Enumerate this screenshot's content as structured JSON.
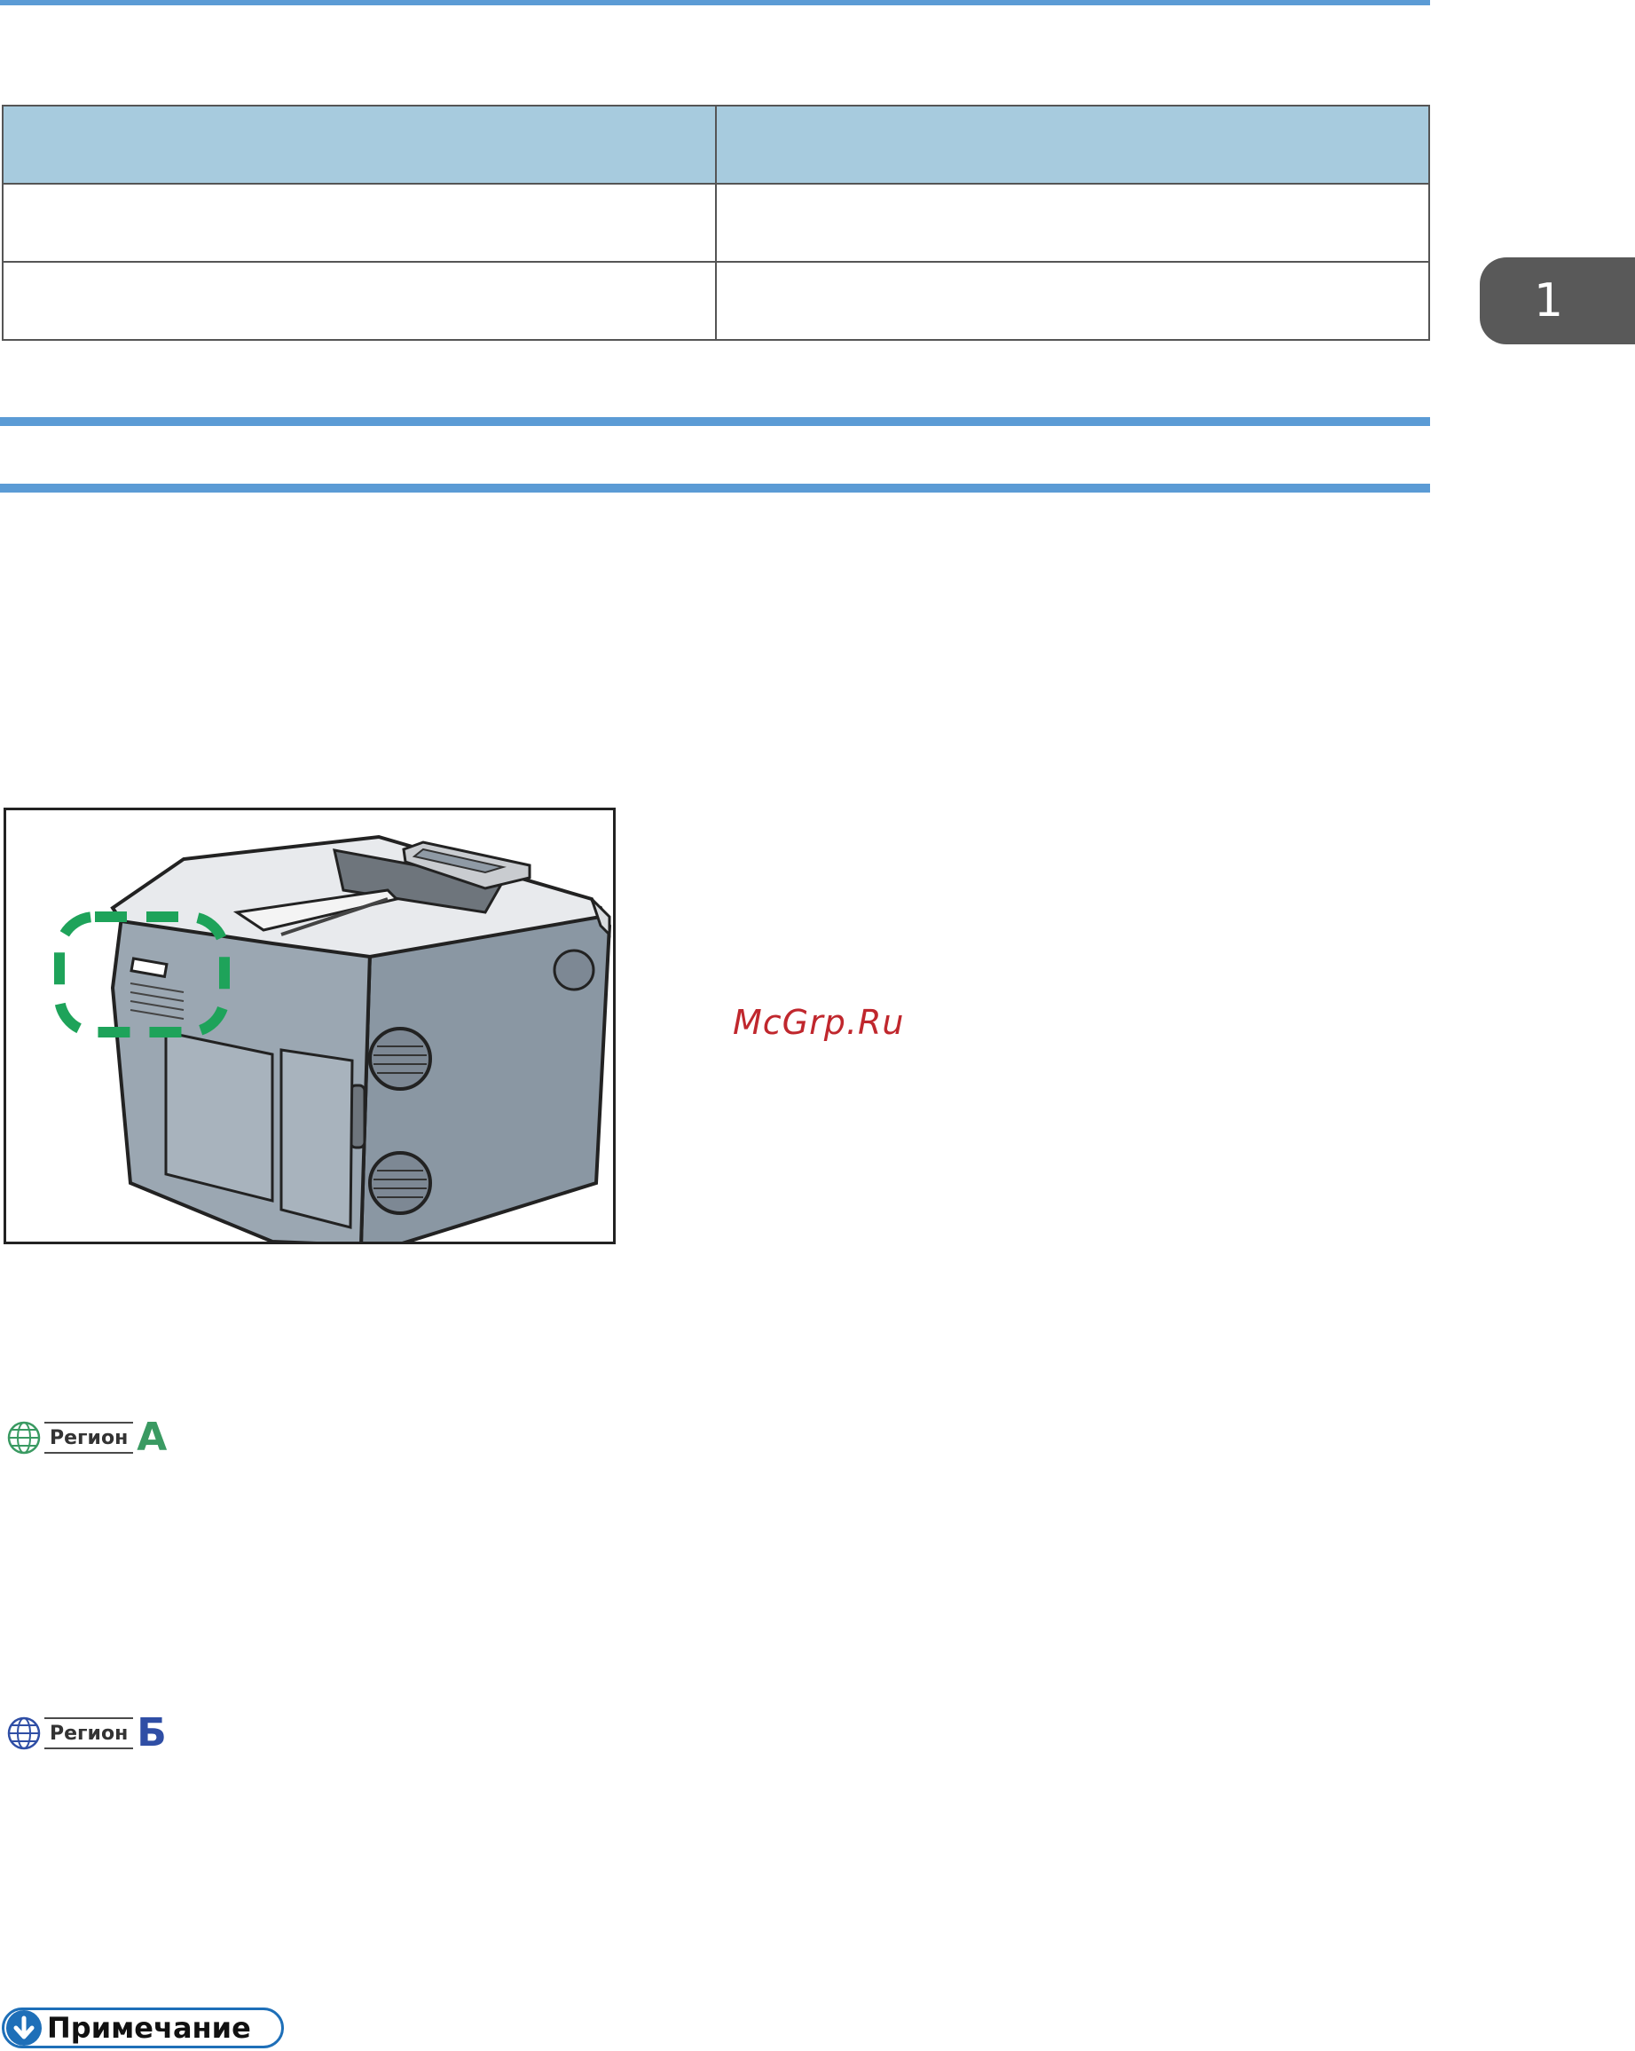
{
  "chapter": {
    "number": "1"
  },
  "table": {
    "header": [
      "",
      ""
    ],
    "rows": [
      [
        "",
        ""
      ],
      [
        "",
        ""
      ]
    ]
  },
  "section": {
    "title": ""
  },
  "watermark": "McGrp.Ru",
  "regions": [
    {
      "label": "Регион",
      "letter": "A"
    },
    {
      "label": "Регион",
      "letter": "Б"
    }
  ],
  "note": {
    "label": "Примечание"
  },
  "colors": {
    "accent": "#5b9bd5",
    "table_header": "#a7cbde",
    "tab": "#595959",
    "highlight": "#1ea35a",
    "note": "#1e6fb8"
  },
  "icons": [
    "globe-icon",
    "down-arrow-icon"
  ]
}
